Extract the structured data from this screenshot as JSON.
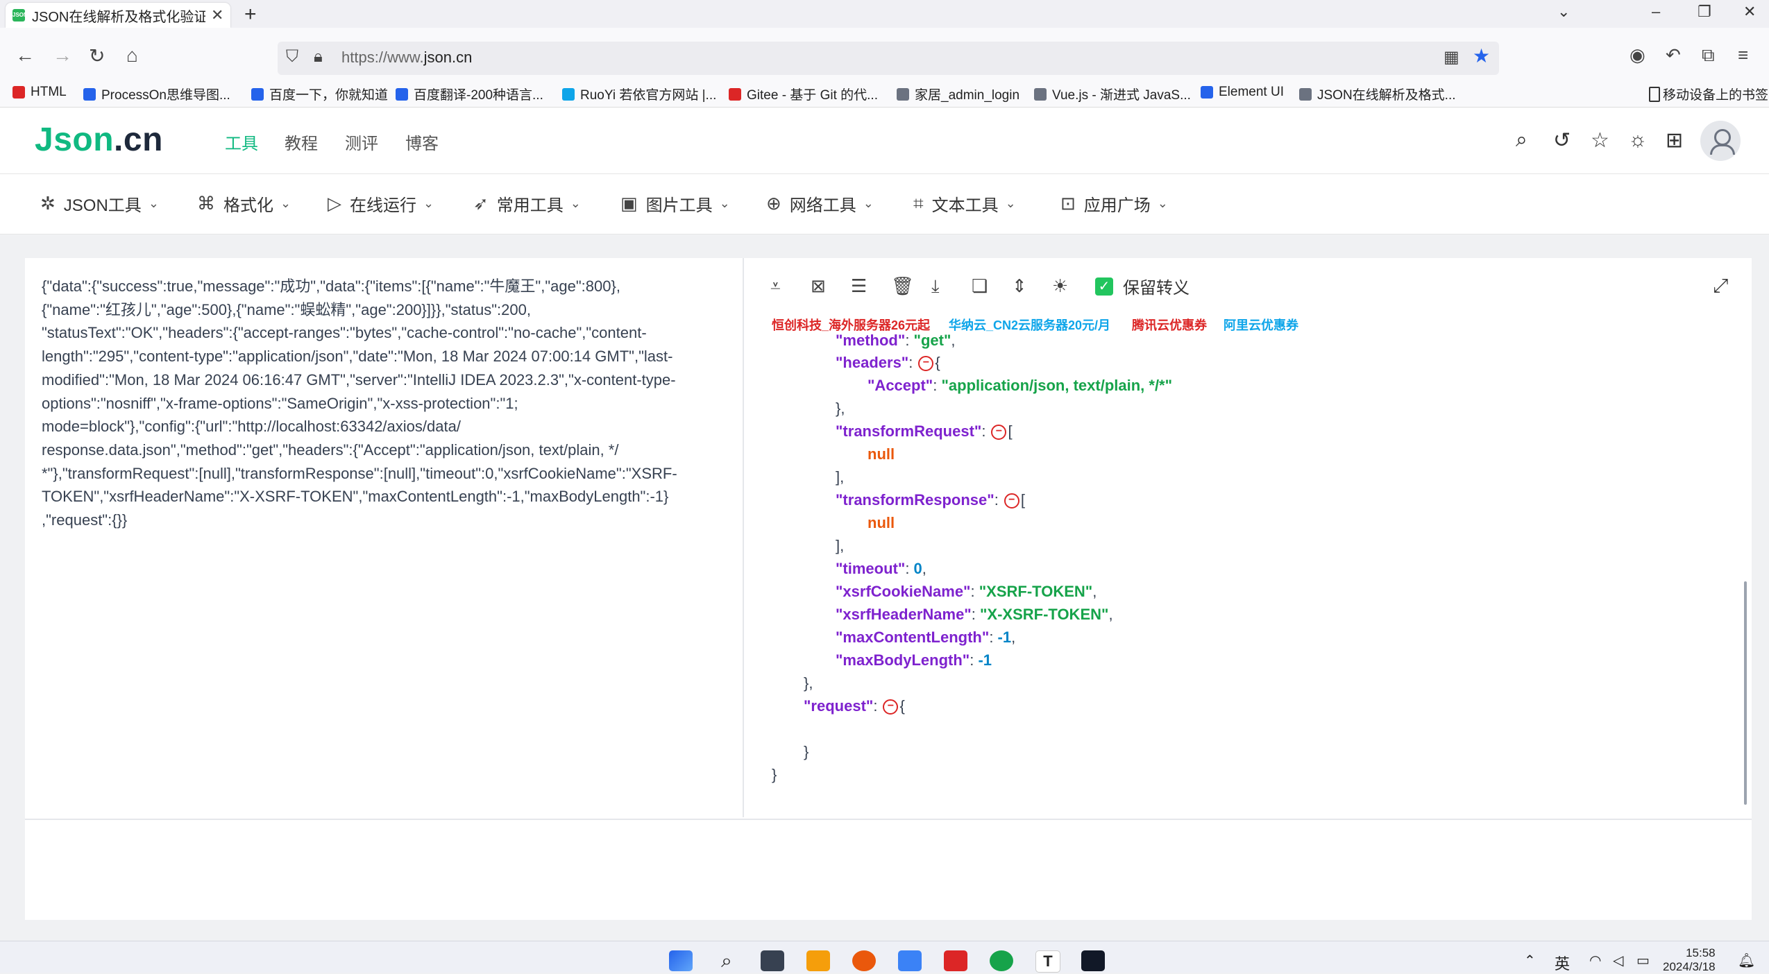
{
  "browser": {
    "tab_title": "JSON在线解析及格式化验证 - JSON.cn",
    "tab_close": "✕",
    "new_tab": "+",
    "url_prefix": "https://www.",
    "url_domain": "json.cn",
    "bookmarks": [
      {
        "label": "HTML",
        "color": "#dc2626"
      },
      {
        "label": "ProcessOn思维导图...",
        "color": "#2563eb"
      },
      {
        "label": "百度一下，你就知道",
        "color": "#2563eb"
      },
      {
        "label": "百度翻译-200种语言...",
        "color": "#2563eb"
      },
      {
        "label": "RuoYi 若依官方网站 |...",
        "color": "#0ea5e9"
      },
      {
        "label": "Gitee - 基于 Git 的代...",
        "color": "#dc2626"
      },
      {
        "label": "家居_admin_login",
        "color": "#6b7280"
      },
      {
        "label": "Vue.js - 渐进式 JavaS...",
        "color": "#6b7280"
      },
      {
        "label": "Element UI",
        "color": "#2563eb"
      },
      {
        "label": "JSON在线解析及格式...",
        "color": "#6b7280"
      }
    ],
    "mobile_bookmarks": "移动设备上的书签"
  },
  "site": {
    "logo_main": "Json",
    "logo_dot": ".cn",
    "topnav": [
      "工具",
      "教程",
      "测评",
      "博客"
    ],
    "menu": [
      {
        "label": "JSON工具",
        "icon": "sparkle-icon",
        "glyph": "✲"
      },
      {
        "label": "格式化",
        "icon": "paint-roller-icon",
        "glyph": "⌘"
      },
      {
        "label": "在线运行",
        "icon": "play-icon",
        "glyph": "▷"
      },
      {
        "label": "常用工具",
        "icon": "rocket-icon",
        "glyph": "➶"
      },
      {
        "label": "图片工具",
        "icon": "image-icon",
        "glyph": "▣"
      },
      {
        "label": "网络工具",
        "icon": "globe-icon",
        "glyph": "⊕"
      },
      {
        "label": "文本工具",
        "icon": "text-frame-icon",
        "glyph": "⌗"
      },
      {
        "label": "应用广场",
        "icon": "bag-icon",
        "glyph": "⊡"
      }
    ]
  },
  "editor": {
    "raw_json": "{\"data\":{\"success\":true,\"message\":\"成功\",\"data\":{\"items\":[{\"name\":\"牛魔王\",\"age\":800},\n{\"name\":\"红孩儿\",\"age\":500},{\"name\":\"蜈蚣精\",\"age\":200}]}},\"status\":200,\n\"statusText\":\"OK\",\"headers\":{\"accept-ranges\":\"bytes\",\"cache-control\":\"no-cache\",\"content-\nlength\":\"295\",\"content-type\":\"application/json\",\"date\":\"Mon, 18 Mar 2024 07:00:14 GMT\",\"last-\nmodified\":\"Mon, 18 Mar 2024 06:16:47 GMT\",\"server\":\"IntelliJ IDEA 2023.2.3\",\"x-content-type-\noptions\":\"nosniff\",\"x-frame-options\":\"SameOrigin\",\"x-xss-protection\":\"1;\nmode=block\"},\"config\":{\"url\":\"http://localhost:63342/axios/data/\nresponse.data.json\",\"method\":\"get\",\"headers\":{\"Accept\":\"application/json, text/plain, */\n*\"},\"transformRequest\":[null],\"transformResponse\":[null],\"timeout\":0,\"xsrfCookieName\":\"XSRF-\nTOKEN\",\"xsrfHeaderName\":\"X-XSRF-TOKEN\",\"maxContentLength\":-1,\"maxBodyLength\":-1}\n,\"request\":{}}",
    "keep_escape_label": "保留转义",
    "ads": [
      {
        "label": "恒创科技_海外服务器26元起",
        "color": "#dc2626"
      },
      {
        "label": "华纳云_CN2云服务器20元/月",
        "color": "#0ea5e9"
      },
      {
        "label": "腾讯云优惠券",
        "color": "#dc2626"
      },
      {
        "label": "阿里云优惠券",
        "color": "#0ea5e9"
      }
    ],
    "tree": {
      "method_key": "\"method\"",
      "method_val": "\"get\"",
      "headers_key": "\"headers\"",
      "accept_key": "\"Accept\"",
      "accept_val": "\"application/json, text/plain, */*\"",
      "transformRequest_key": "\"transformRequest\"",
      "transformResponse_key": "\"transformResponse\"",
      "null_val": "null",
      "timeout_key": "\"timeout\"",
      "timeout_val": "0",
      "xsrfCookieName_key": "\"xsrfCookieName\"",
      "xsrfCookieName_val": "\"XSRF-TOKEN\"",
      "xsrfHeaderName_key": "\"xsrfHeaderName\"",
      "xsrfHeaderName_val": "\"X-XSRF-TOKEN\"",
      "maxContentLength_key": "\"maxContentLength\"",
      "maxContentLength_val": "-1",
      "maxBodyLength_key": "\"maxBodyLength\"",
      "maxBodyLength_val": "-1",
      "request_key": "\"request\""
    }
  },
  "taskbar": {
    "ime": "英",
    "time": "15:58",
    "date": "2024/3/18"
  }
}
